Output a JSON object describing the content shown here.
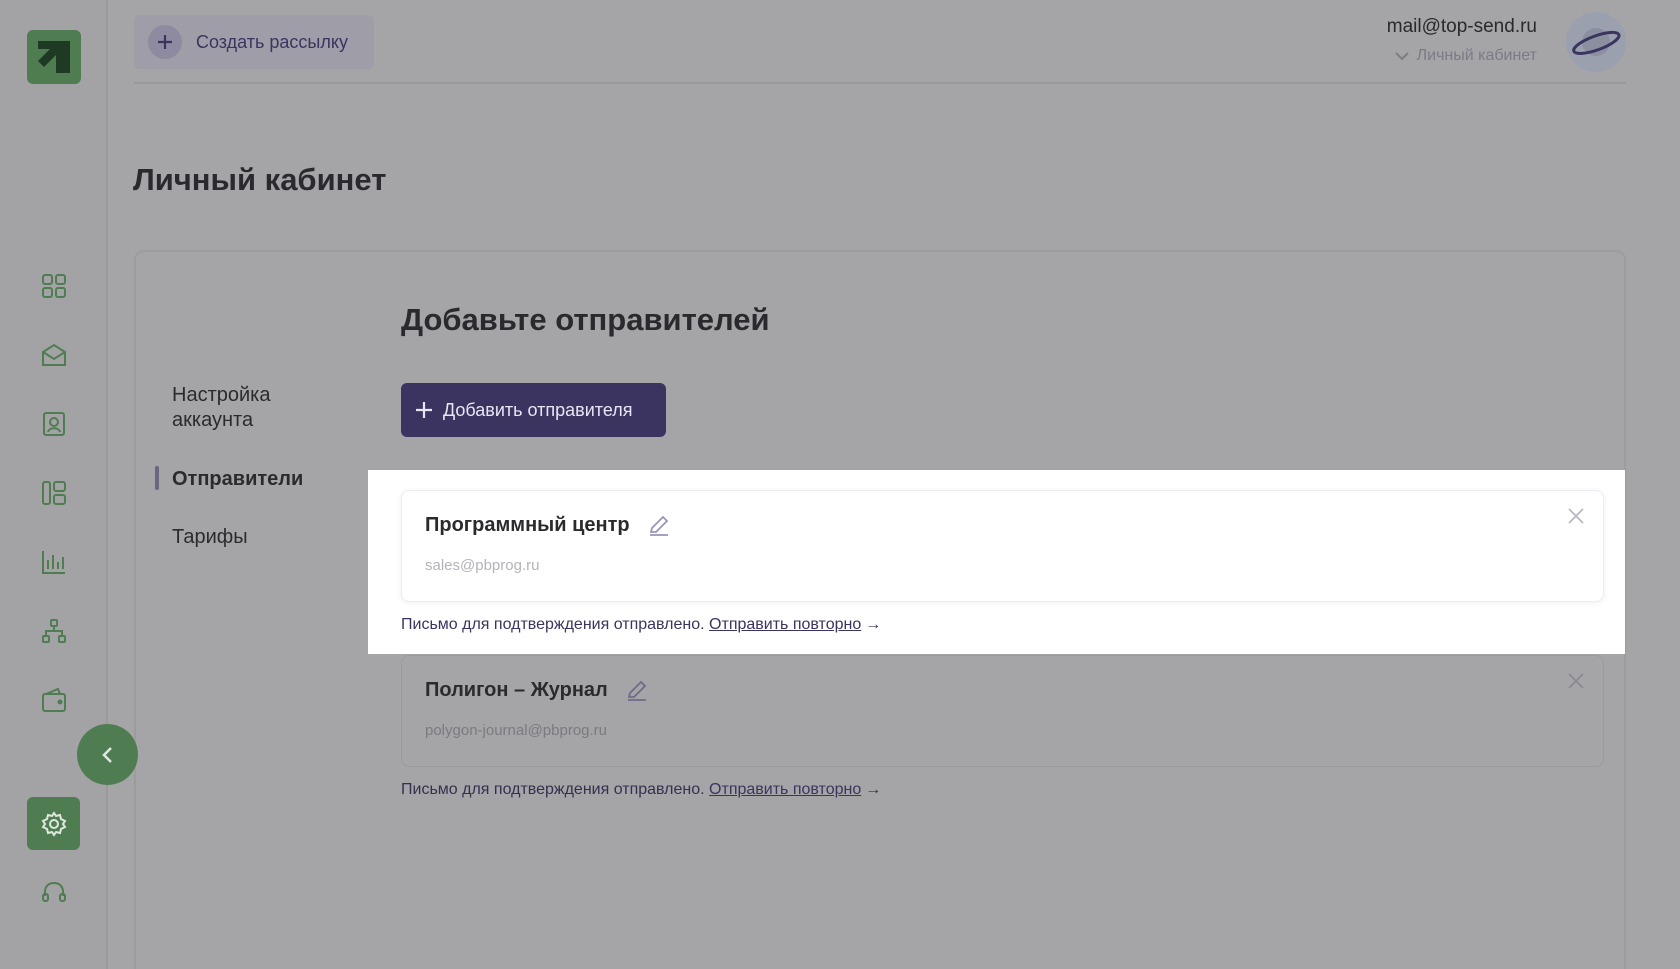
{
  "header": {
    "create_button": "Создать рассылку",
    "user_email": "mail@top-send.ru",
    "user_menu": "Личный кабинет"
  },
  "page": {
    "title": "Личный кабинет"
  },
  "menu": {
    "items": [
      {
        "label": "Настройка аккаунта"
      },
      {
        "label": "Отправители"
      },
      {
        "label": "Тарифы"
      }
    ],
    "active": "Отправители"
  },
  "senders_section": {
    "title": "Добавьте отправителей",
    "add_button": "Добавить отправителя",
    "senders": [
      {
        "name": "Программный центр",
        "email": "sales@pbprog.ru",
        "status_text": "Письмо для подтверждения отправлено.",
        "resend_link": "Отправить повторно",
        "arrow": "→"
      },
      {
        "name": "Полигон – Журнал",
        "email": "polygon-journal@pbprog.ru",
        "status_text": "Письмо для подтверждения отправлено.",
        "resend_link": "Отправить повторно",
        "arrow": "→"
      }
    ]
  },
  "sidebar": {
    "icons": [
      "dashboard-icon",
      "mail-icon",
      "contacts-icon",
      "templates-icon",
      "stats-icon",
      "structure-icon",
      "wallet-icon",
      "settings-icon",
      "support-icon"
    ],
    "accent_color": "#4f7d51"
  },
  "colors": {
    "primary": "#3b3460",
    "accent_green": "#4f7d51"
  }
}
